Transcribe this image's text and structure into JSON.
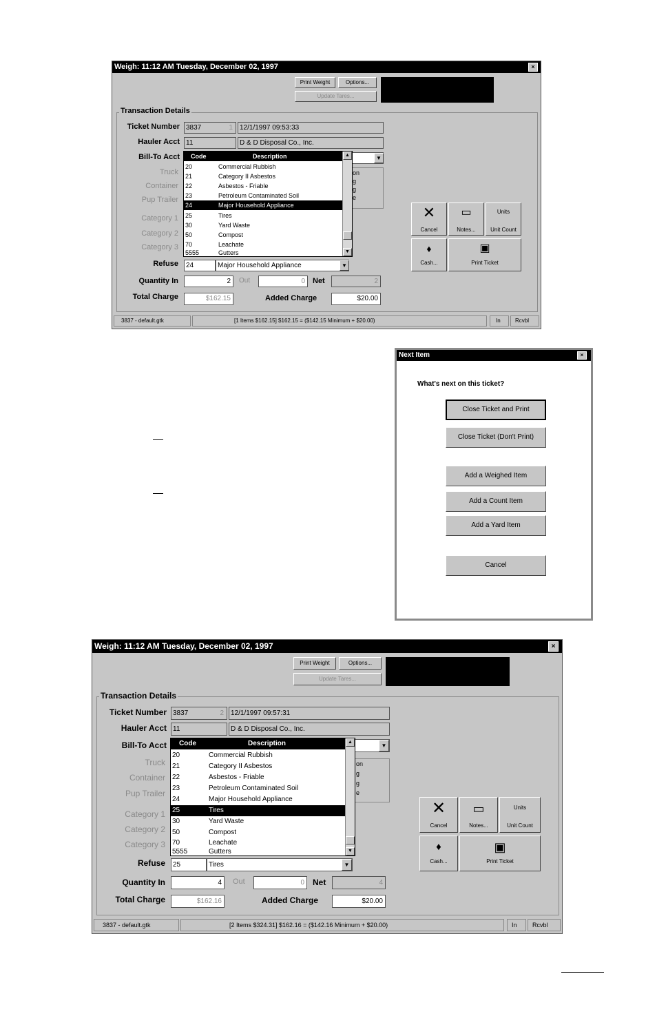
{
  "window1": {
    "title": "Weigh:   11:12 AM    Tuesday, December 02, 1997",
    "close_icon": "close-icon",
    "buttons": {
      "print_weight": "Print Weight",
      "options": "Options...",
      "update_tares": "Update Tares..."
    },
    "group_title": "Transaction Details",
    "labels": {
      "ticket_number": "Ticket Number",
      "hauler_acct": "Hauler Acct",
      "bill_to_acct": "Bill-To Acct",
      "truck": "Truck",
      "container": "Container",
      "pup_trailer": "Pup Trailer",
      "category1": "Category 1",
      "category2": "Category 2",
      "category3": "Category 3",
      "refuse": "Refuse",
      "quantity_in": "Quantity In",
      "out": "Out",
      "net": "Net",
      "total_charge": "Total Charge",
      "added_charge": "Added Charge"
    },
    "fields": {
      "ticket_number": "3837",
      "ticket_seq": "1",
      "ticket_datetime": "12/1/1997 09:53:33",
      "hauler_code": "11",
      "hauler_name": "D & D Disposal Co., Inc.",
      "refuse_code": "24",
      "refuse_desc": "Major Household Appliance",
      "quantity_in": "2",
      "quantity_out": "0",
      "net": "2",
      "total_charge": "$162.15",
      "added_charge": "$20.00"
    },
    "dropdown": {
      "headers": {
        "code": "Code",
        "description": "Description"
      },
      "rows": [
        {
          "code": "20",
          "desc": "Commercial Rubbish"
        },
        {
          "code": "21",
          "desc": "Category II Asbestos"
        },
        {
          "code": "22",
          "desc": "Asbestos - Friable"
        },
        {
          "code": "23",
          "desc": "Petroleum Contaminated Soil"
        },
        {
          "code": "24",
          "desc": "Major Household Appliance"
        },
        {
          "code": "25",
          "desc": "Tires"
        },
        {
          "code": "30",
          "desc": "Yard Waste"
        },
        {
          "code": "50",
          "desc": "Compost"
        },
        {
          "code": "70",
          "desc": "Leachate"
        },
        {
          "code": "5555",
          "desc": "Gutters"
        }
      ]
    },
    "info_lines": [
      "on",
      "g",
      "g",
      "e"
    ],
    "actions": {
      "cancel": "Cancel",
      "notes": "Notes...",
      "units": "Units",
      "unit_count": "Unit Count",
      "cash": "Cash...",
      "print_ticket": "Print Ticket"
    },
    "status": {
      "file": "3837 - default.gtk",
      "summary": "[1 Items  $162.15]    $162.15 = ($142.15 Minimum + $20.00)",
      "mode": "In",
      "role": "Rcvbl"
    }
  },
  "next_item": {
    "title": "Next Item",
    "prompt": "What's next on this ticket?",
    "buttons": {
      "close_print": "Close Ticket and Print",
      "close_no_print": "Close Ticket (Don't Print)",
      "add_weighed": "Add a Weighed Item",
      "add_count": "Add a Count Item",
      "add_yard": "Add a Yard Item",
      "cancel": "Cancel"
    }
  },
  "window2": {
    "title": "Weigh:   11:12 AM    Tuesday, December 02, 1997",
    "buttons": {
      "print_weight": "Print Weight",
      "options": "Options...",
      "update_tares": "Update Tares..."
    },
    "group_title": "Transaction Details",
    "labels": {
      "ticket_number": "Ticket Number",
      "hauler_acct": "Hauler Acct",
      "bill_to_acct": "Bill-To Acct",
      "truck": "Truck",
      "container": "Container",
      "pup_trailer": "Pup Trailer",
      "category1": "Category 1",
      "category2": "Category 2",
      "category3": "Category 3",
      "refuse": "Refuse",
      "quantity_in": "Quantity In",
      "out": "Out",
      "net": "Net",
      "total_charge": "Total Charge",
      "added_charge": "Added Charge"
    },
    "fields": {
      "ticket_number": "3837",
      "ticket_seq": "2",
      "ticket_datetime": "12/1/1997 09:57:31",
      "hauler_code": "11",
      "hauler_name": "D & D Disposal Co., Inc.",
      "refuse_code": "25",
      "refuse_desc": "Tires",
      "quantity_in": "4",
      "quantity_out": "0",
      "net": "4",
      "total_charge": "$162.16",
      "added_charge": "$20.00"
    },
    "dropdown": {
      "headers": {
        "code": "Code",
        "description": "Description"
      },
      "rows": [
        {
          "code": "20",
          "desc": "Commercial Rubbish"
        },
        {
          "code": "21",
          "desc": "Category II Asbestos"
        },
        {
          "code": "22",
          "desc": "Asbestos - Friable"
        },
        {
          "code": "23",
          "desc": "Petroleum Contaminated Soil"
        },
        {
          "code": "24",
          "desc": "Major Household Appliance"
        },
        {
          "code": "25",
          "desc": "Tires"
        },
        {
          "code": "30",
          "desc": "Yard Waste"
        },
        {
          "code": "50",
          "desc": "Compost"
        },
        {
          "code": "70",
          "desc": "Leachate"
        },
        {
          "code": "5555",
          "desc": "Gutters"
        }
      ]
    },
    "info_lines": [
      "on",
      "g",
      "g",
      "e"
    ],
    "actions": {
      "cancel": "Cancel",
      "notes": "Notes...",
      "units": "Units",
      "unit_count": "Unit Count",
      "cash": "Cash...",
      "print_ticket": "Print Ticket"
    },
    "status": {
      "file": "3837 - default.gtk",
      "summary": "[2 Items  $324.31]    $162.16 = ($142.16 Minimum + $20.00)",
      "mode": "In",
      "role": "Rcvbl"
    }
  },
  "icons": {
    "cancel": "x-icon",
    "notes": "notes-icon",
    "cash": "cash-icon",
    "print": "printer-icon",
    "close": "close-icon"
  }
}
